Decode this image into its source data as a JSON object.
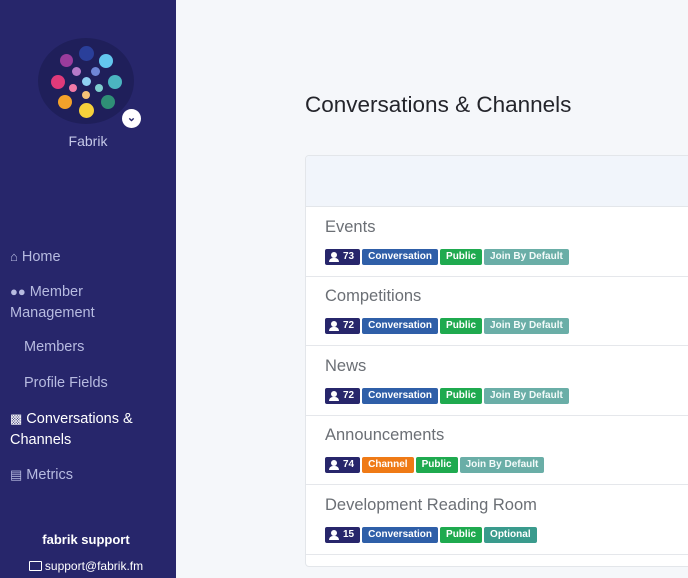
{
  "sidebar": {
    "brand": "Fabrik",
    "nav": {
      "home": "Home",
      "member_management": "Member Management",
      "members": "Members",
      "profile_fields": "Profile Fields",
      "conversations": "Conversations & Channels",
      "metrics": "Metrics"
    },
    "support": {
      "name": "fabrik support",
      "email": "support@fabrik.fm"
    }
  },
  "main": {
    "title": "Conversations & Channels",
    "rows": [
      {
        "name": "Events",
        "count": "73",
        "type": "Conversation",
        "visibility": "Public",
        "join": "Join By Default"
      },
      {
        "name": "Competitions",
        "count": "72",
        "type": "Conversation",
        "visibility": "Public",
        "join": "Join By Default"
      },
      {
        "name": "News",
        "count": "72",
        "type": "Conversation",
        "visibility": "Public",
        "join": "Join By Default"
      },
      {
        "name": "Announcements",
        "count": "74",
        "type": "Channel",
        "visibility": "Public",
        "join": "Join By Default"
      },
      {
        "name": "Development Reading Room",
        "count": "15",
        "type": "Conversation",
        "visibility": "Public",
        "join": "Optional"
      }
    ]
  },
  "colors": {
    "sidebar": "#27266b",
    "conversation": "#2f5fa8",
    "channel": "#ef7a16",
    "public": "#1faa4f",
    "join_by_default": "#6aaea7",
    "optional": "#3a9b8d"
  }
}
